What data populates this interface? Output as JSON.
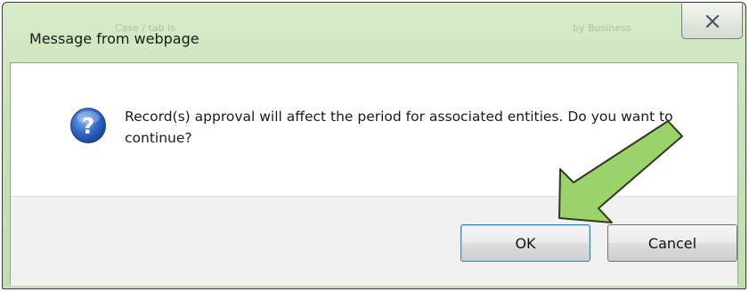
{
  "dialog": {
    "title": "Message from webpage",
    "message": "Record(s) approval will affect the period for associated entities. Do you want to continue?",
    "ok_label": "OK",
    "cancel_label": "Cancel",
    "close_icon": "close-icon",
    "question_icon": "question-icon"
  },
  "background_text": {
    "left": "Case / tab is",
    "right": "by Business"
  },
  "annotation": {
    "arrow_icon": "green-arrow-icon",
    "arrow_color": "#9bd36a"
  }
}
